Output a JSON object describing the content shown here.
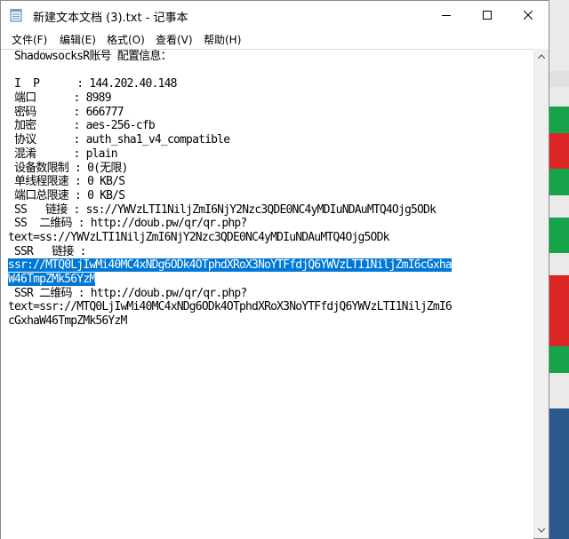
{
  "window": {
    "title": "新建文本文档 (3).txt - 记事本"
  },
  "menu": [
    "文件(F)",
    "编辑(E)",
    "格式(O)",
    "查看(V)",
    "帮助(H)"
  ],
  "lines": [
    "ShadowsocksR账号 配置信息：",
    "",
    "I  P      : 144.202.40.148",
    "端口      : 8989",
    "密码      : 666777",
    "加密      : aes-256-cfb",
    "协议      : auth_sha1_v4_compatible",
    "混淆      : plain",
    "设备数限制 : 0(无限)",
    "单线程限速 : 0 KB/S",
    "端口总限速 : 0 KB/S",
    "SS   链接 : ss://YWVzLTI1NiljZmI6NjY2Nzc3QDE0NC4yMDIuNDAuMTQ4Ojg5ODk",
    "SS  二维码 : http://doub.pw/qr/qr.php?",
    "text=ss://YWVzLTI1NiljZmI6NjY2Nzc3QDE0NC4yMDIuNDAuMTQ4Ojg5ODk",
    "SSR   链接 :",
    "ssr://MTQ0LjIwMi40MC4xNDg6ODk4OTphdXRoX3NoYTFfdjQ6YWVzLTI1NiljZmI6cGxha",
    "W46TmpZMk56YzM",
    "SSR 二维码 : http://doub.pw/qr/qr.php?",
    "text=ssr://MTQ0LjIwMi40MC4xNDg6ODk4OTphdXRoX3NoYTFfdjQ6YWVzLTI1NiljZmI6",
    "cGxhaW46TmpZMk56YzM"
  ]
}
